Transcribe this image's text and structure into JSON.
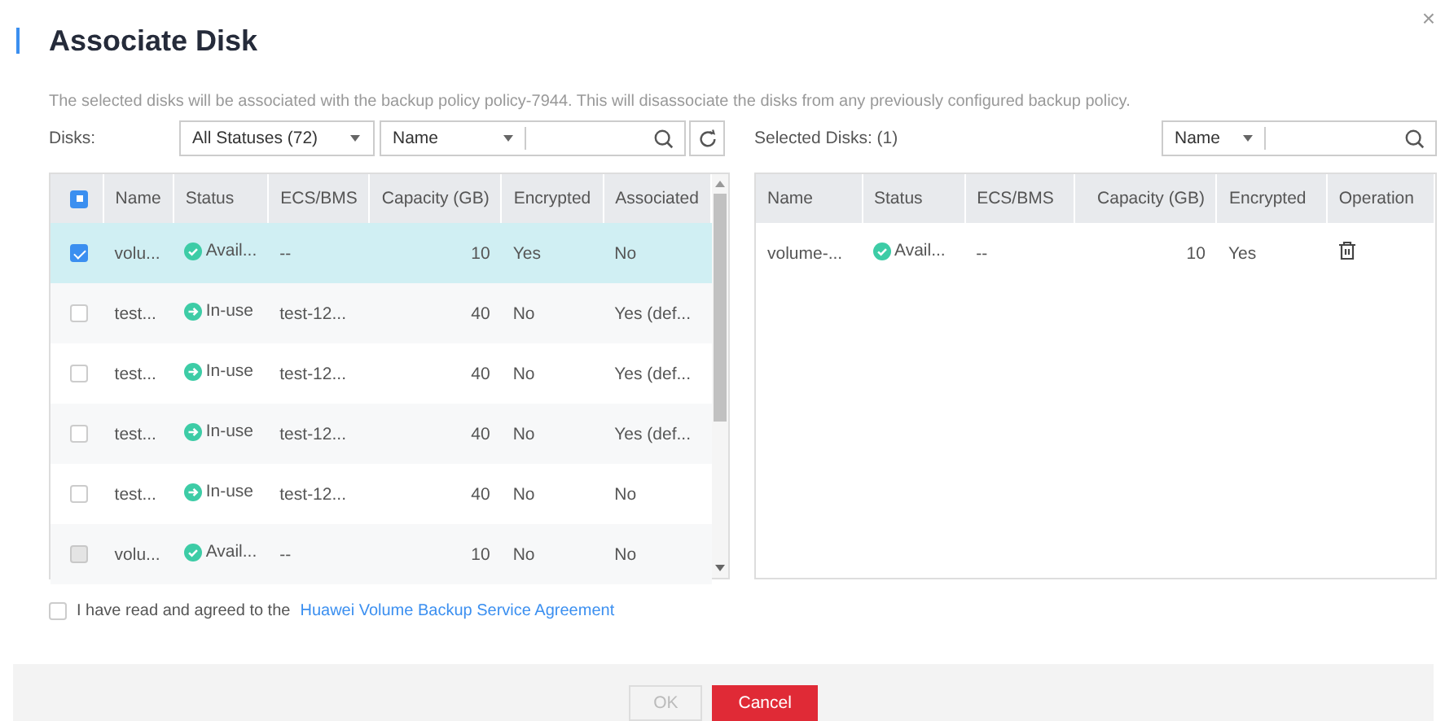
{
  "dialog": {
    "title": "Associate Disk",
    "close": "×"
  },
  "description": "The selected disks will be associated with the backup policy policy-7944. This will disassociate the disks from any previously configured backup policy.",
  "disks": {
    "label": "Disks:",
    "status_filter": "All Statuses (72)",
    "search_by": "Name",
    "table": {
      "header_checkbox": {
        "indeterminate": true
      },
      "columns": [
        "Name",
        "Status",
        "ECS/BMS",
        "Capacity (GB)",
        "Encrypted",
        "Associated"
      ],
      "rows": [
        {
          "selected": true,
          "disabled": false,
          "name": "volu...",
          "status": {
            "kind": "available",
            "text": "Avail..."
          },
          "server": "--",
          "capacity": "10",
          "encrypted": "Yes",
          "associated": "No"
        },
        {
          "selected": false,
          "disabled": false,
          "name": "test...",
          "status": {
            "kind": "in-use",
            "text": "In-use"
          },
          "server": "test-12...",
          "capacity": "40",
          "encrypted": "No",
          "associated": "Yes (def..."
        },
        {
          "selected": false,
          "disabled": false,
          "name": "test...",
          "status": {
            "kind": "in-use",
            "text": "In-use"
          },
          "server": "test-12...",
          "capacity": "40",
          "encrypted": "No",
          "associated": "Yes (def..."
        },
        {
          "selected": false,
          "disabled": false,
          "name": "test...",
          "status": {
            "kind": "in-use",
            "text": "In-use"
          },
          "server": "test-12...",
          "capacity": "40",
          "encrypted": "No",
          "associated": "Yes (def..."
        },
        {
          "selected": false,
          "disabled": false,
          "name": "test...",
          "status": {
            "kind": "in-use",
            "text": "In-use"
          },
          "server": "test-12...",
          "capacity": "40",
          "encrypted": "No",
          "associated": "No"
        },
        {
          "selected": false,
          "disabled": true,
          "name": "volu...",
          "status": {
            "kind": "available",
            "text": "Avail..."
          },
          "server": "--",
          "capacity": "10",
          "encrypted": "No",
          "associated": "No"
        }
      ]
    }
  },
  "selected_disks": {
    "label": "Selected Disks: (1)",
    "search_by": "Name",
    "table": {
      "columns": [
        "Name",
        "Status",
        "ECS/BMS",
        "Capacity (GB)",
        "Encrypted",
        "Operation"
      ],
      "rows": [
        {
          "name": "volume-...",
          "status": {
            "kind": "available",
            "text": "Avail..."
          },
          "server": "--",
          "capacity": "10",
          "encrypted": "Yes"
        }
      ]
    }
  },
  "agreement": {
    "checked": false,
    "text": "I have read and agreed to the",
    "link": "Huawei Volume Backup Service Agreement"
  },
  "buttons": [
    {
      "label": "OK",
      "kind": "primary",
      "disabled": true
    },
    {
      "label": "Cancel",
      "kind": "danger",
      "disabled": false
    }
  ]
}
